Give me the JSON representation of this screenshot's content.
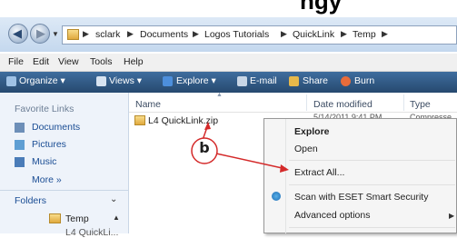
{
  "heading_fragment": "ngy",
  "address": {
    "crumbs": [
      "sclark",
      "Documents",
      "Logos Tutorials",
      "QuickLink",
      "Temp"
    ]
  },
  "menu": [
    "File",
    "Edit",
    "View",
    "Tools",
    "Help"
  ],
  "toolbar": {
    "organize": "Organize",
    "views": "Views",
    "explore": "Explore",
    "email": "E-mail",
    "share": "Share",
    "burn": "Burn"
  },
  "left_pane": {
    "favorites_heading": "Favorite Links",
    "favorites": [
      "Documents",
      "Pictures",
      "Music"
    ],
    "more": "More »",
    "folders_heading": "Folders",
    "tree_item": "Temp",
    "tree_item_partial": "L4 QuickLi..."
  },
  "columns": {
    "name": "Name",
    "date_modified": "Date modified",
    "type": "Type"
  },
  "file": {
    "name": "L4 QuickLink.zip",
    "date": "5/14/2011 9:41 PM",
    "type": "Compresse"
  },
  "context_menu": {
    "items": [
      "Explore",
      "Open",
      "Extract All...",
      "Scan with ESET Smart Security",
      "Advanced options"
    ]
  },
  "annotation": {
    "label": "b",
    "color": "#d42a2a"
  }
}
